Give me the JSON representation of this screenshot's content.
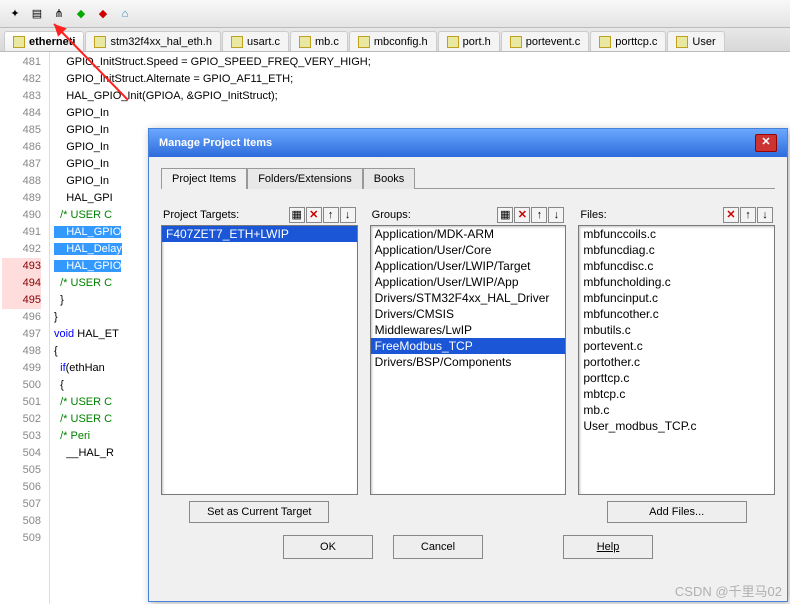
{
  "toolbar": {
    "icons": [
      "wand-icon",
      "stack-icon",
      "tree-icon",
      "diamond-green-icon",
      "diamond-red-icon",
      "house-icon"
    ]
  },
  "tabs": [
    {
      "label": "etherneti",
      "active": true
    },
    {
      "label": "stm32f4xx_hal_eth.h",
      "active": false
    },
    {
      "label": "usart.c",
      "active": false
    },
    {
      "label": "mb.c",
      "active": false
    },
    {
      "label": "mbconfig.h",
      "active": false
    },
    {
      "label": "port.h",
      "active": false
    },
    {
      "label": "portevent.c",
      "active": false
    },
    {
      "label": "porttcp.c",
      "active": false
    },
    {
      "label": "User",
      "active": false
    }
  ],
  "code": {
    "lines": [
      {
        "n": 481,
        "t": "    GPIO_InitStruct.Speed = GPIO_SPEED_FREQ_VERY_HIGH;"
      },
      {
        "n": 482,
        "t": "    GPIO_InitStruct.Alternate = GPIO_AF11_ETH;"
      },
      {
        "n": 483,
        "t": "    HAL_GPIO_Init(GPIOA, &GPIO_InitStruct);"
      },
      {
        "n": 484,
        "t": ""
      },
      {
        "n": 485,
        "t": "    GPIO_In"
      },
      {
        "n": 486,
        "t": "    GPIO_In"
      },
      {
        "n": 487,
        "t": "    GPIO_In"
      },
      {
        "n": 488,
        "t": "    GPIO_In"
      },
      {
        "n": 489,
        "t": "    GPIO_In"
      },
      {
        "n": 490,
        "t": "    HAL_GPI"
      },
      {
        "n": 491,
        "t": ""
      },
      {
        "n": 492,
        "t": "  /* USER C",
        "cm": true
      },
      {
        "n": 493,
        "t": "    HAL_GPIO",
        "sel": true,
        "bp": true
      },
      {
        "n": 494,
        "t": "    HAL_Delay",
        "sel": true,
        "bp": true
      },
      {
        "n": 495,
        "t": "    HAL_GPIO",
        "sel": true,
        "bp": true
      },
      {
        "n": 496,
        "t": "  /* USER C",
        "cm": true
      },
      {
        "n": 497,
        "t": "  }"
      },
      {
        "n": 498,
        "t": "}"
      },
      {
        "n": 499,
        "t": ""
      },
      {
        "n": 500,
        "t": "void HAL_ET",
        "kw": "void"
      },
      {
        "n": 501,
        "t": "{"
      },
      {
        "n": 502,
        "t": "  if(ethHan",
        "kw": "if"
      },
      {
        "n": 503,
        "t": "  {"
      },
      {
        "n": 504,
        "t": "  /* USER C",
        "cm": true
      },
      {
        "n": 505,
        "t": ""
      },
      {
        "n": 506,
        "t": "  /* USER C",
        "cm": true
      },
      {
        "n": 507,
        "t": "  /* Peri",
        "cm": true
      },
      {
        "n": 508,
        "t": "    __HAL_R"
      },
      {
        "n": 509,
        "t": ""
      }
    ]
  },
  "dialog": {
    "title": "Manage Project Items",
    "tabs": [
      "Project Items",
      "Folders/Extensions",
      "Books"
    ],
    "active_tab": 0,
    "cols": {
      "targets_label": "Project Targets:",
      "groups_label": "Groups:",
      "files_label": "Files:"
    },
    "targets": [
      "F407ZET7_ETH+LWIP"
    ],
    "groups": [
      "Application/MDK-ARM",
      "Application/User/Core",
      "Application/User/LWIP/Target",
      "Application/User/LWIP/App",
      "Drivers/STM32F4xx_HAL_Driver",
      "Drivers/CMSIS",
      "Middlewares/LwIP",
      "FreeModbus_TCP",
      "Drivers/BSP/Components"
    ],
    "groups_sel": 7,
    "files": [
      "mbfunccoils.c",
      "mbfuncdiag.c",
      "mbfuncdisc.c",
      "mbfuncholding.c",
      "mbfuncinput.c",
      "mbfuncother.c",
      "mbutils.c",
      "portevent.c",
      "portother.c",
      "porttcp.c",
      "mbtcp.c",
      "mb.c",
      "User_modbus_TCP.c"
    ],
    "set_target_btn": "Set as Current Target",
    "add_files_btn": "Add Files...",
    "ok": "OK",
    "cancel": "Cancel",
    "help": "Help"
  },
  "watermark": "CSDN @千里马02"
}
